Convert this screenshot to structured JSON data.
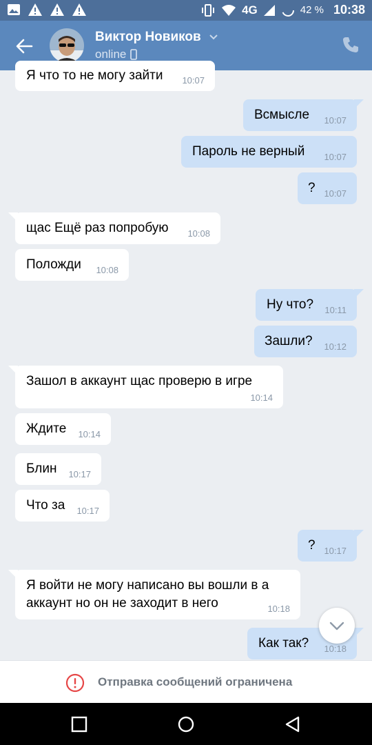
{
  "status_bar": {
    "notification_icons": [
      "image-icon",
      "warning-icon",
      "warning-icon",
      "warning-icon"
    ],
    "network": "4G",
    "battery": "42 %",
    "time": "10:38"
  },
  "header": {
    "contact_name": "Виктор Новиков",
    "status": "online"
  },
  "messages": [
    {
      "dir": "in",
      "text": "Я что то не могу зайти",
      "time": "10:07"
    },
    {
      "dir": "out",
      "text": "Всмысле",
      "time": "10:07"
    },
    {
      "dir": "out",
      "text": "Пароль не верный",
      "time": "10:07"
    },
    {
      "dir": "out",
      "text": "?",
      "time": "10:07"
    },
    {
      "dir": "in",
      "text": "щас Ещё раз попробую",
      "time": "10:08"
    },
    {
      "dir": "in",
      "text": "Положди",
      "time": "10:08"
    },
    {
      "dir": "out",
      "text": "Ну что?",
      "time": "10:11"
    },
    {
      "dir": "out",
      "text": "Зашли?",
      "time": "10:12"
    },
    {
      "dir": "in",
      "text": "Зашол в аккаунт щас проверю в игре",
      "time": "10:14"
    },
    {
      "dir": "in",
      "text": "Ждите",
      "time": "10:14"
    },
    {
      "dir": "in",
      "text": "Блин",
      "time": "10:17"
    },
    {
      "dir": "in",
      "text": "Что за",
      "time": "10:17"
    },
    {
      "dir": "out",
      "text": "?",
      "time": "10:17"
    },
    {
      "dir": "in",
      "text": "Я войти не могу написано вы вошли в а аккаунт но он не заходит в него",
      "time": "10:18"
    },
    {
      "dir": "out",
      "text": "Как так?",
      "time": "10:18"
    }
  ],
  "restriction_notice": "Отправка сообщений ограничена",
  "colors": {
    "header_bg": "#5b88bd",
    "status_bar_bg": "#4d6f9a",
    "chat_bg": "#ebeef2",
    "incoming_bubble": "#ffffff",
    "outgoing_bubble": "#cce0f7",
    "warning_red": "#e64646"
  }
}
